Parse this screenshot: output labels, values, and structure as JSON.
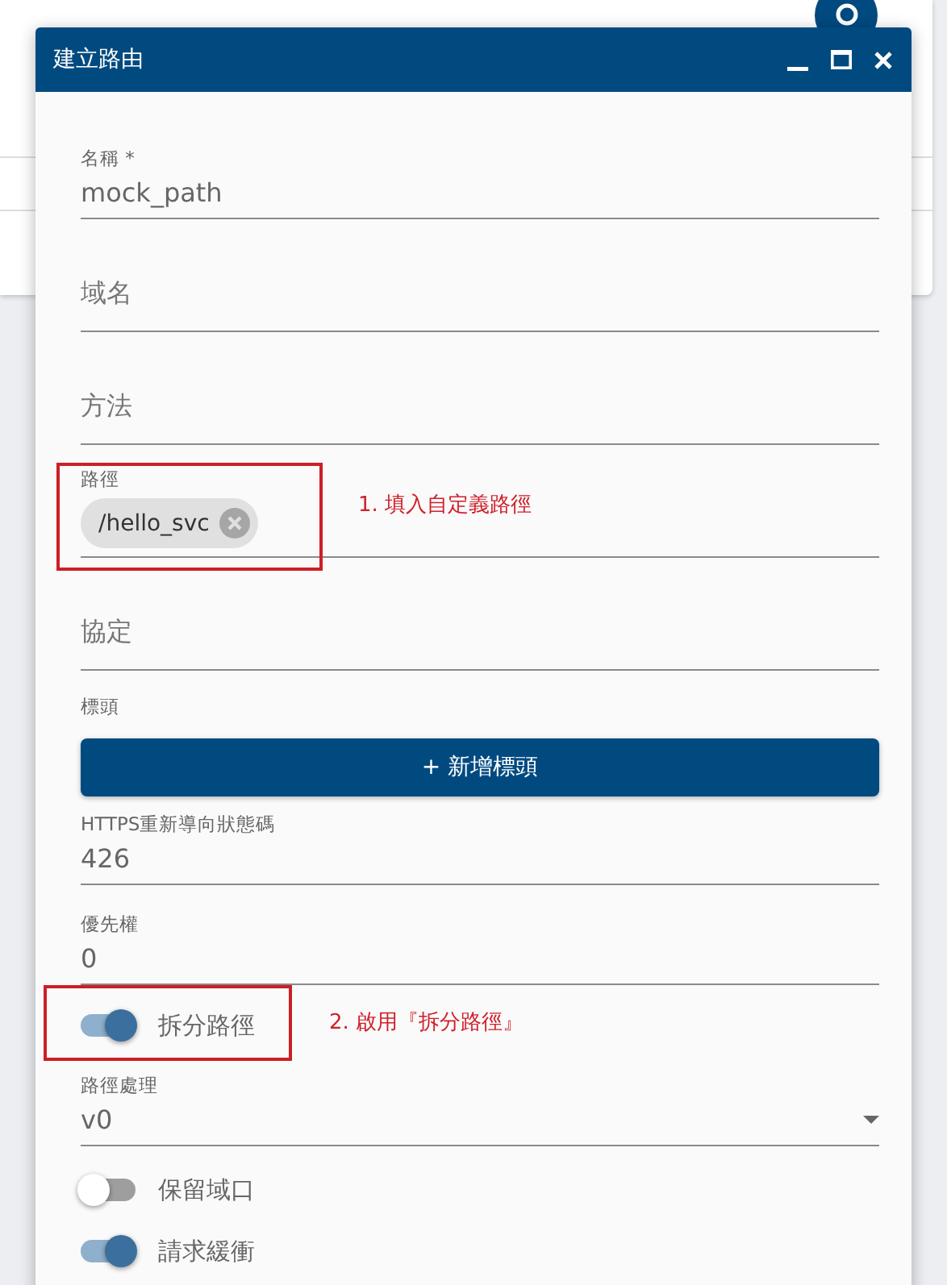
{
  "dialog": {
    "title": "建立路由"
  },
  "fields": [
    {
      "kind": "text",
      "label": "名稱 *",
      "value": "mock_path"
    },
    {
      "kind": "text",
      "placeholder": "域名"
    },
    {
      "kind": "text",
      "placeholder": "方法"
    },
    {
      "kind": "chips",
      "label": "路徑",
      "chips": [
        "/hello_svc"
      ],
      "annotation": "1. 填入自定義路徑"
    },
    {
      "kind": "text",
      "placeholder": "協定"
    },
    {
      "kind": "button",
      "label": "標頭",
      "button": "+ 新增標頭"
    },
    {
      "kind": "text",
      "label": "HTTPS重新導向狀態碼",
      "value": "426"
    },
    {
      "kind": "text",
      "label": "優先權",
      "value": "0"
    },
    {
      "kind": "switch",
      "label": "拆分路徑",
      "on": true,
      "annotation": "2. 啟用『拆分路徑』"
    },
    {
      "kind": "select",
      "label": "路徑處理",
      "value": "v0"
    },
    {
      "kind": "switch",
      "label": "保留域口",
      "on": false
    },
    {
      "kind": "switch",
      "label": "請求緩衝",
      "on": true
    }
  ]
}
